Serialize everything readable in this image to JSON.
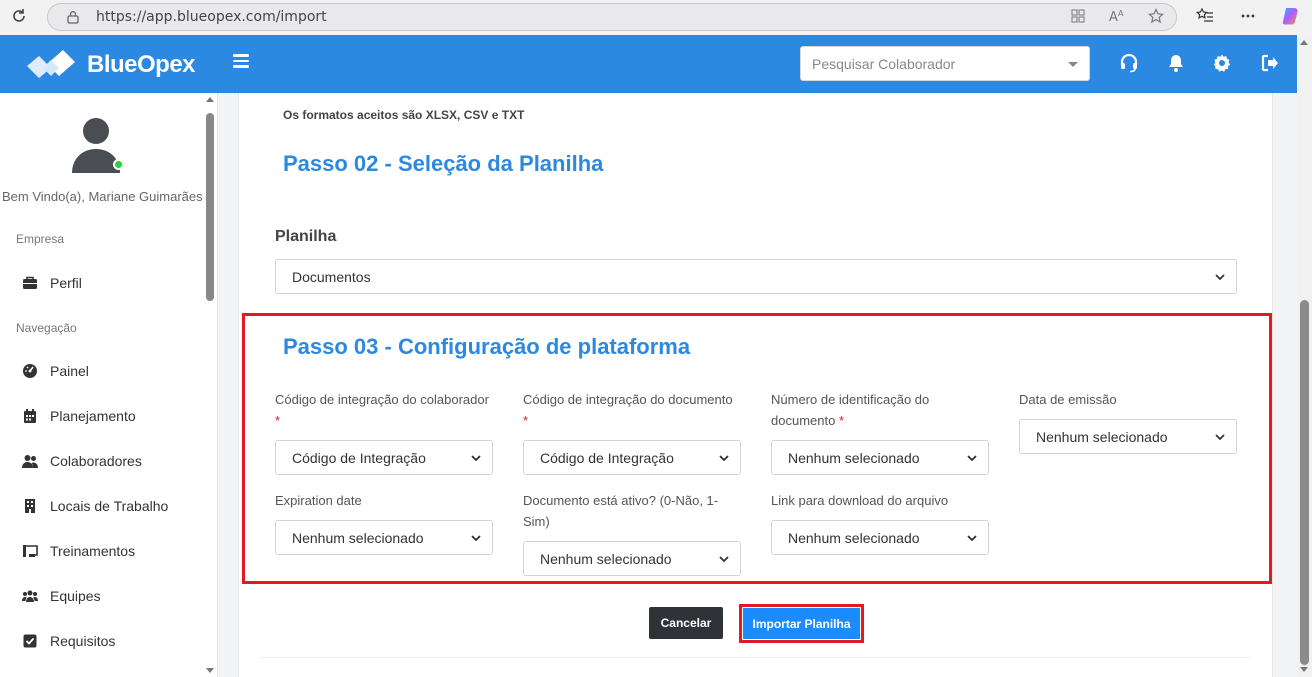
{
  "browser": {
    "url": "https://app.blueopex.com/import"
  },
  "header": {
    "brand": "BlueOpex",
    "search_placeholder": "Pesquisar Colaborador",
    "brand_color": "#2b89e2",
    "icons": [
      "headset-icon",
      "bell-icon",
      "gear-icon",
      "logout-icon"
    ]
  },
  "sidebar": {
    "welcome": "Bem Vindo(a), Mariane Guimarães",
    "empresa_label": "Empresa",
    "navegacao_label": "Navegação",
    "empresa_items": [
      {
        "label": "Perfil",
        "icon": "briefcase-icon"
      }
    ],
    "nav_items": [
      {
        "label": "Painel",
        "icon": "gauge-icon"
      },
      {
        "label": "Planejamento",
        "icon": "calendar-icon"
      },
      {
        "label": "Colaboradores",
        "icon": "users-icon"
      },
      {
        "label": "Locais de Trabalho",
        "icon": "building-icon"
      },
      {
        "label": "Treinamentos",
        "icon": "chalkboard-icon"
      },
      {
        "label": "Equipes",
        "icon": "team-icon"
      },
      {
        "label": "Requisitos",
        "icon": "checkbox-icon"
      }
    ]
  },
  "main": {
    "formats_note": "Os formatos aceitos são XLSX, CSV e TXT",
    "step2_title": "Passo 02 - Seleção da Planilha",
    "planilha_label": "Planilha",
    "planilha_value": "Documentos",
    "step3_title": "Passo 03 - Configuração de plataforma",
    "fields": [
      {
        "label": "Código de integração do colaborador",
        "required": true,
        "value": "Código de Integração"
      },
      {
        "label": "Código de integração do documento",
        "required": true,
        "value": "Código de Integração"
      },
      {
        "label": "Número de identificação do documento",
        "required": true,
        "value": "Nenhum selecionado"
      },
      {
        "label": "Data de emissão",
        "required": false,
        "value": "Nenhum selecionado"
      },
      {
        "label": "Expiration date",
        "required": false,
        "value": "Nenhum selecionado"
      },
      {
        "label": "Documento está ativo? (0-Não, 1-Sim)",
        "required": false,
        "value": "Nenhum selecionado"
      },
      {
        "label": "Link para download do arquivo",
        "required": false,
        "value": "Nenhum selecionado"
      }
    ],
    "required_mark": "*",
    "cancel_label": "Cancelar",
    "import_label": "Importar Planilha",
    "highlight_color": "#e01b24"
  }
}
